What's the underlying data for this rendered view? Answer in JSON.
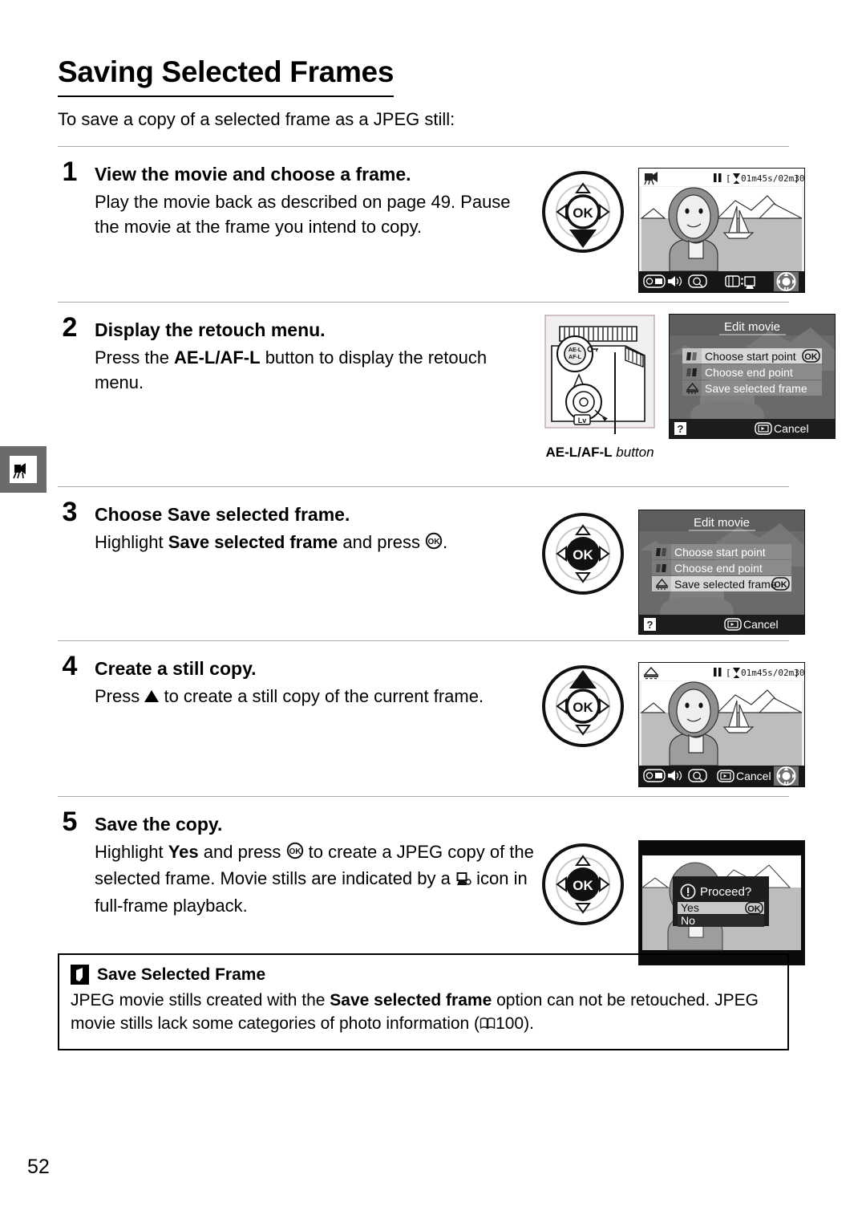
{
  "page": {
    "number": "52",
    "chapter_tab_icon": "movie-camera-icon"
  },
  "header": {
    "title": "Saving Selected Frames",
    "intro": "To save a copy of a selected frame as a JPEG still:"
  },
  "steps": [
    {
      "number": "1",
      "title": "View the movie and choose a frame.",
      "body_pre": "Play the movie back as described on page 49.  Pause the movie at the frame you intend to copy.",
      "dpad": "down",
      "screen": {
        "type": "playback",
        "corner_icon": "movie-camera-icon",
        "pause_icon": "pause-icon",
        "timecode": "01m45s/02m30s",
        "bottom_left_icons": [
          "zoom-out-thumbnail-icon",
          "volume-icon",
          "zoom-in-icon"
        ],
        "bottom_center": "retouch-menu-icon",
        "bottom_right_icon": "multi-selector-guide-icon"
      }
    },
    {
      "number": "2",
      "title": "Display the retouch menu.",
      "body_pre": "Press the ",
      "body_bold": "AE-L/AF-L",
      "body_post": " button to display the retouch menu.",
      "camera_caption_bold": "AE-L/AF-L",
      "camera_caption_italic": "button",
      "screen": {
        "type": "menu",
        "title": "Edit movie",
        "items": [
          {
            "icon": "choose-start-point-icon",
            "label": "Choose start point",
            "highlighted": true,
            "badge": "OK"
          },
          {
            "icon": "choose-end-point-icon",
            "label": "Choose end point",
            "highlighted": false,
            "badge": ""
          },
          {
            "icon": "save-selected-frame-icon",
            "label": "Save selected frame",
            "highlighted": false,
            "badge": ""
          }
        ],
        "help_icon": "question-mark-icon",
        "footer_button": "playback-icon",
        "footer_label": "Cancel"
      }
    },
    {
      "number": "3",
      "title_pre": "Choose ",
      "title_bold": "Save selected frame",
      "title_post": ".",
      "body_pre": "Highlight ",
      "body_bold": "Save selected frame",
      "body_post": " and press ",
      "body_icon": "ok-button-icon",
      "body_end": ".",
      "dpad": "ok",
      "screen": {
        "type": "menu",
        "title": "Edit movie",
        "items": [
          {
            "icon": "choose-start-point-icon",
            "label": "Choose start point",
            "highlighted": false,
            "badge": ""
          },
          {
            "icon": "choose-end-point-icon",
            "label": "Choose end point",
            "highlighted": false,
            "badge": ""
          },
          {
            "icon": "save-selected-frame-icon",
            "label": "Save selected frame",
            "highlighted": true,
            "badge": "OK"
          }
        ],
        "help_icon": "question-mark-icon",
        "footer_button": "playback-icon",
        "footer_label": "Cancel"
      }
    },
    {
      "number": "4",
      "title": "Create a still copy.",
      "body_pre": "Press ",
      "body_icon": "up-triangle-icon",
      "body_post": " to create a still copy of the current frame.",
      "dpad": "up",
      "screen": {
        "type": "playback",
        "corner_icon": "save-selected-frame-icon",
        "pause_icon": "pause-icon",
        "timecode": "01m45s/02m30s",
        "bottom_left_icons": [
          "zoom-out-thumbnail-icon",
          "volume-icon",
          "zoom-in-icon"
        ],
        "bottom_center_button": "playback-icon",
        "bottom_center_label": "Cancel",
        "bottom_right_icon": "multi-selector-guide-icon"
      }
    },
    {
      "number": "5",
      "title": "Save the copy.",
      "body_pre": "Highlight ",
      "body_bold": "Yes",
      "body_mid": " and press ",
      "body_icon": "ok-button-icon",
      "body_post": " to create a JPEG copy of the selected frame.  Movie stills are indicated by a ",
      "body_icon2": "movie-still-icon",
      "body_end": " icon in full-frame playback.",
      "dpad": "ok",
      "screen": {
        "type": "dialog",
        "dialog_icon": "exclamation-icon",
        "dialog_title": "Proceed?",
        "options": [
          {
            "label": "Yes",
            "highlighted": true,
            "badge": "OK"
          },
          {
            "label": "No",
            "highlighted": false,
            "badge": ""
          }
        ]
      }
    }
  ],
  "note": {
    "badge_icon": "pencil-note-icon",
    "heading": "Save Selected Frame",
    "text_pre": "JPEG movie stills created with the ",
    "text_bold": "Save selected frame",
    "text_mid": " option can not be retouched.  JPEG movie stills lack some categories of photo information (",
    "ref_icon": "book-icon",
    "ref_page": "100",
    "text_end": ")."
  },
  "colors": {
    "tab_gray": "#6b6b6b",
    "rule_gray": "#a9a9a9",
    "lcd_bg": "#d8d8d8",
    "lcd_menu_bg": "#5a5a5a",
    "lcd_highlight": "#d5d5d5"
  }
}
